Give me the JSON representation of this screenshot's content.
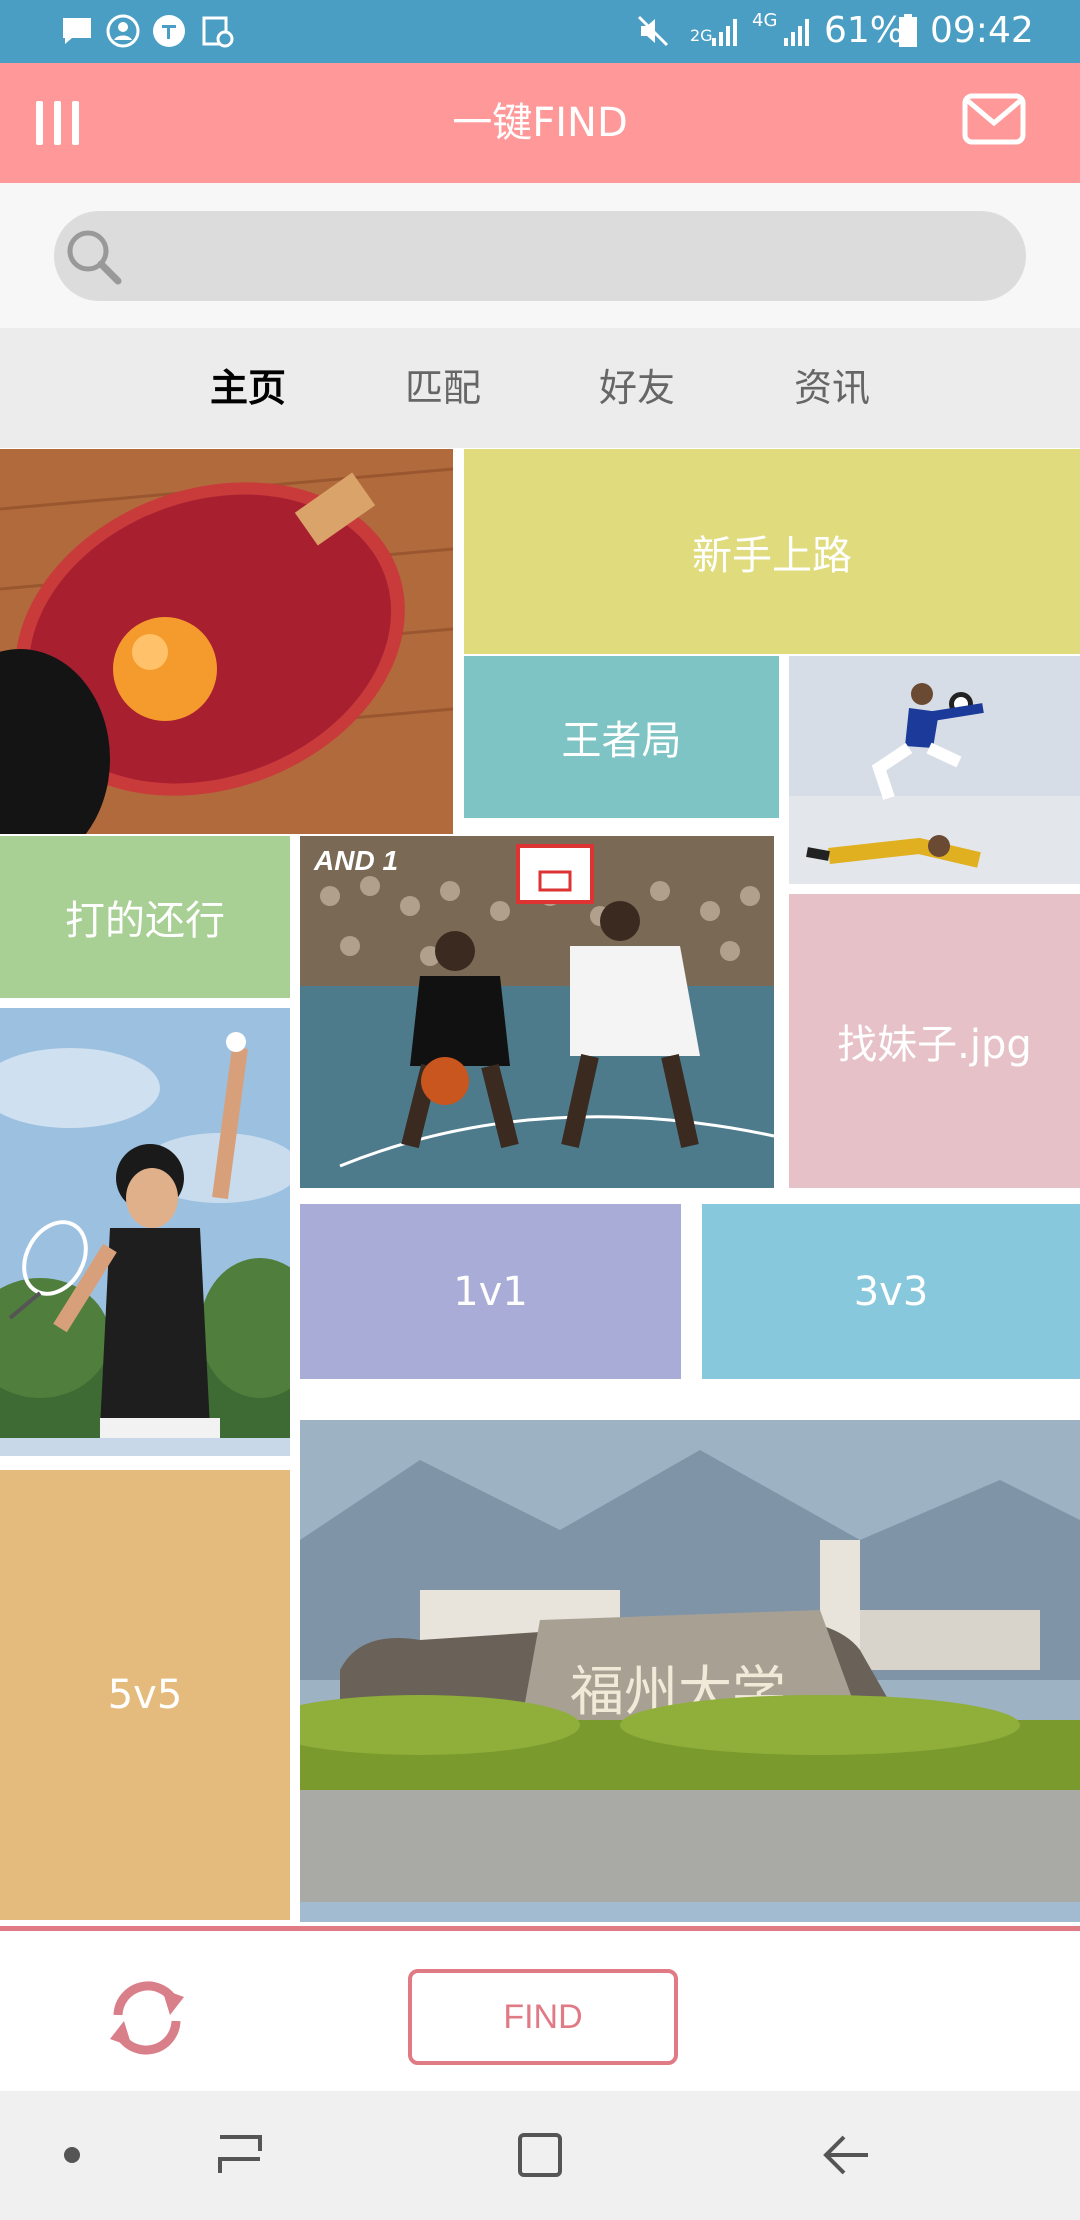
{
  "status_bar": {
    "battery_percent": "61%",
    "time": "09:42",
    "network_2g": "2G",
    "network_4g": "4G",
    "left_icons": [
      "message-icon",
      "account-circle-icon",
      "zhihu-icon",
      "calendar-clock-icon"
    ],
    "right_icons": [
      "mute-icon",
      "signal-2g-icon",
      "signal-4g-icon",
      "battery-icon"
    ]
  },
  "app_bar": {
    "title": "一键FIND",
    "menu_icon": "menu-bars-icon",
    "mail_icon": "mail-icon"
  },
  "search": {
    "placeholder": "",
    "icon": "search-icon"
  },
  "tabs": [
    {
      "label": "主页",
      "active": true
    },
    {
      "label": "匹配",
      "active": false
    },
    {
      "label": "好友",
      "active": false
    },
    {
      "label": "资讯",
      "active": false
    }
  ],
  "tiles": {
    "newbie": {
      "label": "新手上路",
      "color": "#e0dc7e"
    },
    "king": {
      "label": "王者局",
      "color": "#7fc4c4"
    },
    "casual": {
      "label": "打的还行",
      "color": "#a8cf94"
    },
    "find_girl": {
      "label": "找妹子.jpg",
      "color": "#e6c1c7"
    },
    "one_v_one": {
      "label": "1v1",
      "color": "#a8acd6"
    },
    "three_v_three": {
      "label": "3v3",
      "color": "#88c8dc"
    },
    "five_v_five": {
      "label": "5v5",
      "color": "#e4bb7c"
    }
  },
  "photos": {
    "table_tennis": "table-tennis-photo",
    "soccer": "soccer-photo",
    "basketball": "basketball-photo",
    "basketball_logo": "AND 1",
    "badminton": "badminton-photo",
    "campus": "campus-gate-photo"
  },
  "bottom_bar": {
    "refresh_icon": "refresh-icon",
    "find_label": "FIND"
  },
  "nav_bar": {
    "icons": [
      "dot-icon",
      "recent-apps-icon",
      "home-icon",
      "back-icon"
    ]
  },
  "colors": {
    "status_bar": "#4a9ec4",
    "app_bar": "#ff9999",
    "accent": "#e07a85"
  }
}
